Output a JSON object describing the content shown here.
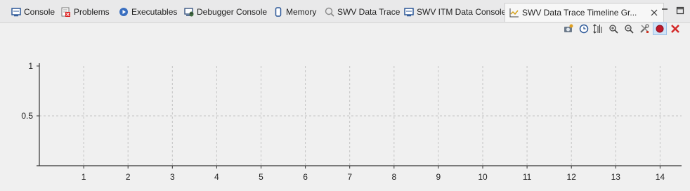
{
  "tabs": [
    {
      "label": "Console",
      "icon": "console-icon"
    },
    {
      "label": "Problems",
      "icon": "problems-icon"
    },
    {
      "label": "Executables",
      "icon": "executables-icon"
    },
    {
      "label": "Debugger Console",
      "icon": "debugger-console-icon"
    },
    {
      "label": "Memory",
      "icon": "memory-icon"
    },
    {
      "label": "SWV Data Trace",
      "icon": "search-icon"
    },
    {
      "label": "SWV ITM Data Console",
      "icon": "console-icon"
    },
    {
      "label": "SWV Data Trace Timeline Gr...",
      "icon": "timeline-graph-icon",
      "active": true
    }
  ],
  "toolbar": [
    "snapshot-icon",
    "clock-icon",
    "scale-icon",
    "zoom-in-icon",
    "zoom-out-icon",
    "tools-icon",
    "record-icon",
    "close-red-icon"
  ],
  "chart_data": {
    "type": "line",
    "title": "",
    "xlabel": "",
    "ylabel": "",
    "xlim": [
      0,
      14.5
    ],
    "ylim": [
      0,
      1
    ],
    "x_ticks": [
      "1",
      "2",
      "3",
      "4",
      "5",
      "6",
      "7",
      "8",
      "9",
      "10",
      "11",
      "12",
      "13",
      "14"
    ],
    "y_ticks": [
      "0.5",
      "1"
    ],
    "grid": true,
    "series": []
  }
}
